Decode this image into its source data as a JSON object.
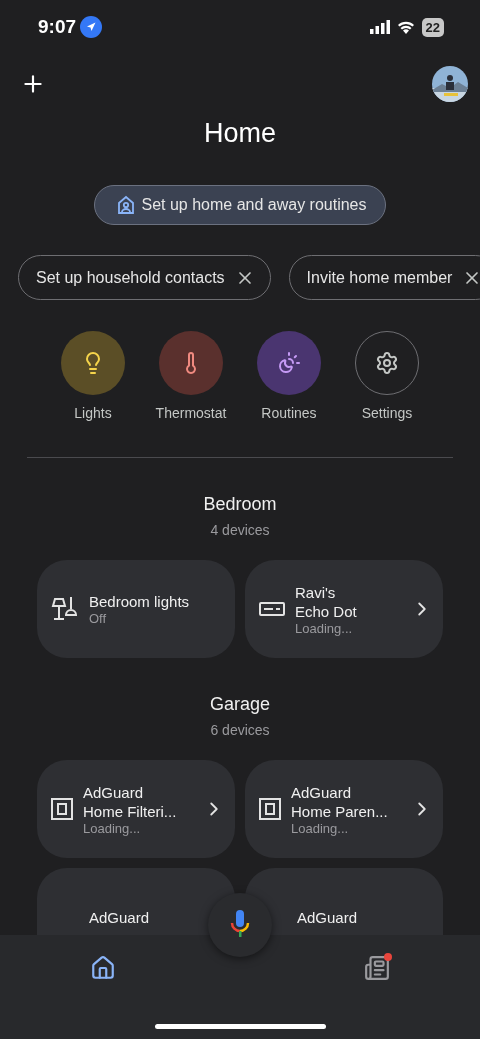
{
  "status_bar": {
    "time": "9:07",
    "battery": "22",
    "location_active": true
  },
  "top_bar": {
    "title": "Home"
  },
  "routine_pill": {
    "label": "Set up home and away routines"
  },
  "chips": [
    {
      "label": "Set up household contacts"
    },
    {
      "label": "Invite home member"
    }
  ],
  "shortcuts": [
    {
      "kind": "lights",
      "label": "Lights",
      "color": "#f5d44b"
    },
    {
      "kind": "thermostat",
      "label": "Thermostat",
      "color": "#f08a80"
    },
    {
      "kind": "routines",
      "label": "Routines",
      "color": "#c59af5"
    },
    {
      "kind": "settings",
      "label": "Settings",
      "color": "#c4c7c5"
    }
  ],
  "rooms": [
    {
      "name": "Bedroom",
      "count": "4 devices",
      "devices": [
        {
          "kind": "lamp",
          "name": "Bedroom lights",
          "status": "Off",
          "chevron": false
        },
        {
          "kind": "speaker",
          "name": "Ravi's\nEcho Dot",
          "status": "Loading...",
          "chevron": true
        }
      ]
    },
    {
      "name": "Garage",
      "count": "6 devices",
      "devices": [
        {
          "kind": "box",
          "name": "AdGuard\nHome Filteri...",
          "status": "Loading...",
          "chevron": true
        },
        {
          "kind": "box",
          "name": "AdGuard\nHome Paren...",
          "status": "Loading...",
          "chevron": true
        },
        {
          "name": "AdGuard",
          "chevron": false
        },
        {
          "name": "AdGuard",
          "chevron": false
        }
      ]
    }
  ],
  "bottom_nav": [
    {
      "kind": "home",
      "selected": true,
      "badge": false
    },
    {
      "kind": "feed",
      "selected": false,
      "badge": true
    }
  ]
}
